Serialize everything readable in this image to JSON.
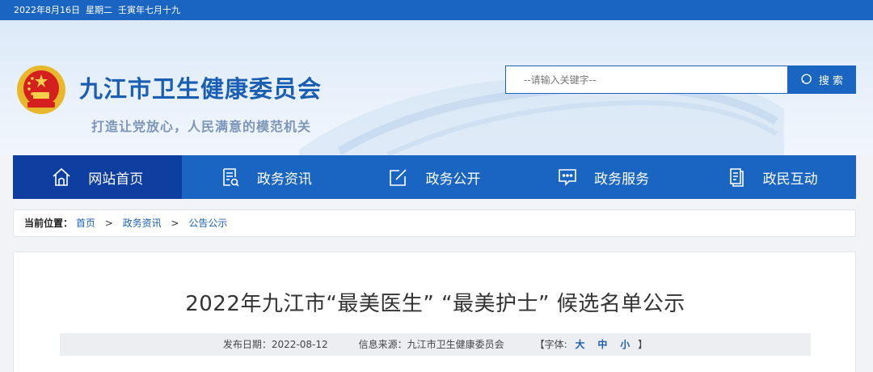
{
  "topbar": {
    "date_text": "2022年8月16日  星期二  壬寅年七月十九"
  },
  "header": {
    "site_title": "九江市卫生健康委员会",
    "slogan": "打造让党放心，人民满意的模范机关",
    "search_placeholder": "--请输入关键字--",
    "search_button": "搜 索"
  },
  "nav": {
    "items": [
      {
        "label": "网站首页",
        "icon": "home-icon",
        "active": true
      },
      {
        "label": "政务资讯",
        "icon": "document-search-icon"
      },
      {
        "label": "政务公开",
        "icon": "edit-icon"
      },
      {
        "label": "政务服务",
        "icon": "chat-icon"
      },
      {
        "label": "政民互动",
        "icon": "clipboard-icon"
      }
    ]
  },
  "breadcrumb": {
    "label": "当前位置：",
    "items": [
      "首页",
      "政务资讯",
      "公告公示"
    ],
    "separator": ">"
  },
  "article": {
    "title": "2022年九江市“最美医生” “最美护士” 候选名单公示",
    "publish_date": "发布日期：2022-08-12",
    "source": "信息来源：九江市卫生健康委员会",
    "font_label_open": "【字体:",
    "font_sizes": [
      "大",
      "中",
      "小"
    ],
    "font_label_close": "】"
  },
  "colors": {
    "primary": "#1a64c2",
    "nav_active": "#0e3ea0",
    "title_blue": "#1a5fb4"
  }
}
